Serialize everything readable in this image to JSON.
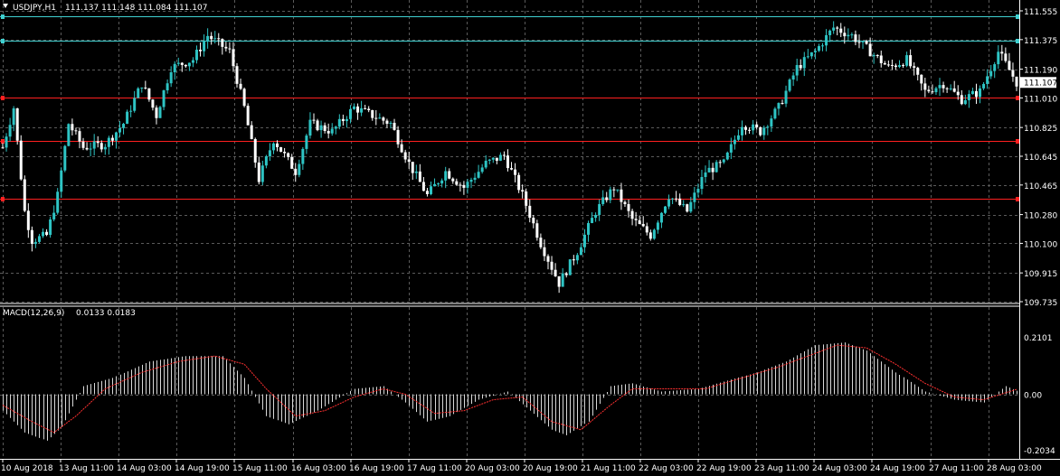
{
  "window": {
    "symbol_title": "USDJPY,H1",
    "ohlc": "111.137 111.148 111.084 111.107"
  },
  "indicator": {
    "title": "MACD(12,26,9)",
    "values": "0.0133 0.0183"
  },
  "colors": {
    "background": "#000000",
    "bull": "#2ec4c4",
    "bear": "#ffffff",
    "signal": "#ff3030",
    "support": "#ff2020",
    "resistance": "#40d0d0",
    "grid": "#5a5a5a"
  },
  "chart_data": [
    {
      "type": "candlestick",
      "grid": true,
      "ylim": [
        109.735,
        111.555
      ],
      "current_price": "111.107",
      "y_ticks": [
        "111.555",
        "111.375",
        "111.190",
        "111.010",
        "110.825",
        "110.645",
        "110.465",
        "110.280",
        "110.100",
        "109.915",
        "109.735"
      ],
      "x_ticks": [
        "10 Aug 2018",
        "13 Aug 11:00",
        "14 Aug 03:00",
        "14 Aug 19:00",
        "15 Aug 11:00",
        "16 Aug 03:00",
        "16 Aug 19:00",
        "17 Aug 11:00",
        "20 Aug 03:00",
        "20 Aug 19:00",
        "21 Aug 11:00",
        "22 Aug 03:00",
        "22 Aug 19:00",
        "23 Aug 11:00",
        "24 Aug 03:00",
        "24 Aug 19:00",
        "27 Aug 11:00",
        "28 Aug 03:00"
      ],
      "horizontal_levels": [
        {
          "kind": "resistance",
          "price": 111.52
        },
        {
          "kind": "resistance",
          "price": 111.37
        },
        {
          "kind": "support",
          "price": 111.01
        },
        {
          "kind": "support",
          "price": 110.74
        },
        {
          "kind": "support",
          "price": 110.38
        }
      ],
      "close_path": [
        {
          "t": 0,
          "p": 110.7
        },
        {
          "t": 3,
          "p": 110.95
        },
        {
          "t": 6,
          "p": 110.3
        },
        {
          "t": 8,
          "p": 110.12
        },
        {
          "t": 12,
          "p": 110.15
        },
        {
          "t": 15,
          "p": 110.4
        },
        {
          "t": 18,
          "p": 110.85
        },
        {
          "t": 22,
          "p": 110.7
        },
        {
          "t": 28,
          "p": 110.72
        },
        {
          "t": 33,
          "p": 110.85
        },
        {
          "t": 38,
          "p": 111.1
        },
        {
          "t": 42,
          "p": 110.9
        },
        {
          "t": 46,
          "p": 111.2
        },
        {
          "t": 52,
          "p": 111.25
        },
        {
          "t": 56,
          "p": 111.4
        },
        {
          "t": 62,
          "p": 111.3
        },
        {
          "t": 66,
          "p": 110.95
        },
        {
          "t": 70,
          "p": 110.5
        },
        {
          "t": 74,
          "p": 110.75
        },
        {
          "t": 80,
          "p": 110.55
        },
        {
          "t": 84,
          "p": 110.85
        },
        {
          "t": 90,
          "p": 110.8
        },
        {
          "t": 96,
          "p": 110.95
        },
        {
          "t": 101,
          "p": 110.9
        },
        {
          "t": 106,
          "p": 110.85
        },
        {
          "t": 111,
          "p": 110.6
        },
        {
          "t": 116,
          "p": 110.4
        },
        {
          "t": 121,
          "p": 110.55
        },
        {
          "t": 126,
          "p": 110.45
        },
        {
          "t": 132,
          "p": 110.6
        },
        {
          "t": 137,
          "p": 110.65
        },
        {
          "t": 142,
          "p": 110.4
        },
        {
          "t": 147,
          "p": 110.1
        },
        {
          "t": 152,
          "p": 109.85
        },
        {
          "t": 157,
          "p": 110.05
        },
        {
          "t": 162,
          "p": 110.3
        },
        {
          "t": 167,
          "p": 110.45
        },
        {
          "t": 172,
          "p": 110.25
        },
        {
          "t": 177,
          "p": 110.15
        },
        {
          "t": 182,
          "p": 110.4
        },
        {
          "t": 187,
          "p": 110.3
        },
        {
          "t": 192,
          "p": 110.55
        },
        {
          "t": 197,
          "p": 110.6
        },
        {
          "t": 202,
          "p": 110.85
        },
        {
          "t": 207,
          "p": 110.8
        },
        {
          "t": 212,
          "p": 110.95
        },
        {
          "t": 217,
          "p": 111.2
        },
        {
          "t": 222,
          "p": 111.3
        },
        {
          "t": 227,
          "p": 111.45
        },
        {
          "t": 232,
          "p": 111.4
        },
        {
          "t": 237,
          "p": 111.3
        },
        {
          "t": 242,
          "p": 111.2
        },
        {
          "t": 247,
          "p": 111.25
        },
        {
          "t": 252,
          "p": 111.05
        },
        {
          "t": 257,
          "p": 111.1
        },
        {
          "t": 262,
          "p": 111.0
        },
        {
          "t": 267,
          "p": 111.05
        },
        {
          "t": 272,
          "p": 111.3
        },
        {
          "t": 277,
          "p": 111.107
        }
      ]
    },
    {
      "type": "bar",
      "title": "MACD(12,26,9)",
      "ylim": [
        -0.2034,
        0.2101
      ],
      "y_ticks": [
        "0.2101",
        "0.00",
        "-0.2034"
      ],
      "histogram_path": [
        {
          "t": 0,
          "v": -0.06
        },
        {
          "t": 6,
          "v": -0.14
        },
        {
          "t": 12,
          "v": -0.17
        },
        {
          "t": 16,
          "v": -0.12
        },
        {
          "t": 22,
          "v": 0.03
        },
        {
          "t": 30,
          "v": 0.06
        },
        {
          "t": 40,
          "v": 0.12
        },
        {
          "t": 50,
          "v": 0.14
        },
        {
          "t": 60,
          "v": 0.14
        },
        {
          "t": 66,
          "v": 0.06
        },
        {
          "t": 72,
          "v": -0.08
        },
        {
          "t": 78,
          "v": -0.11
        },
        {
          "t": 86,
          "v": -0.06
        },
        {
          "t": 96,
          "v": 0.02
        },
        {
          "t": 104,
          "v": 0.03
        },
        {
          "t": 110,
          "v": -0.03
        },
        {
          "t": 116,
          "v": -0.1
        },
        {
          "t": 122,
          "v": -0.08
        },
        {
          "t": 130,
          "v": -0.02
        },
        {
          "t": 138,
          "v": 0.01
        },
        {
          "t": 144,
          "v": -0.06
        },
        {
          "t": 150,
          "v": -0.13
        },
        {
          "t": 154,
          "v": -0.15
        },
        {
          "t": 160,
          "v": -0.1
        },
        {
          "t": 166,
          "v": 0.03
        },
        {
          "t": 172,
          "v": 0.04
        },
        {
          "t": 180,
          "v": 0.01
        },
        {
          "t": 190,
          "v": 0.02
        },
        {
          "t": 198,
          "v": 0.05
        },
        {
          "t": 206,
          "v": 0.08
        },
        {
          "t": 214,
          "v": 0.12
        },
        {
          "t": 222,
          "v": 0.18
        },
        {
          "t": 230,
          "v": 0.19
        },
        {
          "t": 236,
          "v": 0.16
        },
        {
          "t": 244,
          "v": 0.08
        },
        {
          "t": 252,
          "v": 0.01
        },
        {
          "t": 260,
          "v": -0.02
        },
        {
          "t": 268,
          "v": -0.03
        },
        {
          "t": 274,
          "v": 0.03
        },
        {
          "t": 277,
          "v": 0.013
        }
      ],
      "signal_path": [
        {
          "t": 0,
          "v": -0.04
        },
        {
          "t": 8,
          "v": -0.1
        },
        {
          "t": 14,
          "v": -0.14
        },
        {
          "t": 20,
          "v": -0.08
        },
        {
          "t": 28,
          "v": 0.02
        },
        {
          "t": 38,
          "v": 0.08
        },
        {
          "t": 48,
          "v": 0.12
        },
        {
          "t": 58,
          "v": 0.14
        },
        {
          "t": 66,
          "v": 0.11
        },
        {
          "t": 72,
          "v": 0.02
        },
        {
          "t": 80,
          "v": -0.08
        },
        {
          "t": 88,
          "v": -0.06
        },
        {
          "t": 96,
          "v": -0.01
        },
        {
          "t": 104,
          "v": 0.02
        },
        {
          "t": 110,
          "v": 0.0
        },
        {
          "t": 118,
          "v": -0.07
        },
        {
          "t": 126,
          "v": -0.06
        },
        {
          "t": 134,
          "v": -0.02
        },
        {
          "t": 142,
          "v": -0.01
        },
        {
          "t": 150,
          "v": -0.1
        },
        {
          "t": 158,
          "v": -0.13
        },
        {
          "t": 166,
          "v": -0.04
        },
        {
          "t": 172,
          "v": 0.02
        },
        {
          "t": 182,
          "v": 0.02
        },
        {
          "t": 192,
          "v": 0.02
        },
        {
          "t": 202,
          "v": 0.06
        },
        {
          "t": 212,
          "v": 0.1
        },
        {
          "t": 220,
          "v": 0.14
        },
        {
          "t": 228,
          "v": 0.18
        },
        {
          "t": 236,
          "v": 0.17
        },
        {
          "t": 244,
          "v": 0.11
        },
        {
          "t": 252,
          "v": 0.04
        },
        {
          "t": 260,
          "v": -0.01
        },
        {
          "t": 268,
          "v": -0.02
        },
        {
          "t": 277,
          "v": 0.018
        }
      ]
    }
  ]
}
